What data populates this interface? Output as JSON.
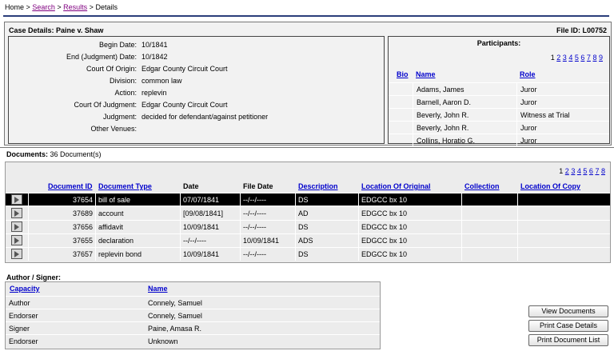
{
  "breadcrumb": {
    "home": "Home",
    "sep": ">",
    "search": "Search",
    "results": "Results",
    "current": "Details"
  },
  "case": {
    "title": "Case Details: Paine v. Shaw",
    "file_id": "File ID: L00752",
    "details": [
      {
        "label": "Begin Date:",
        "value": "10/1841"
      },
      {
        "label": "End (Judgment) Date:",
        "value": "10/1842"
      },
      {
        "label": "Court Of Origin:",
        "value": "Edgar County Circuit Court"
      },
      {
        "label": "Division:",
        "value": "common law"
      },
      {
        "label": "Action:",
        "value": "replevin"
      },
      {
        "label": "Court Of Judgment:",
        "value": "Edgar County Circuit Court"
      },
      {
        "label": "Judgment:",
        "value": "decided for defendant/against petitioner"
      },
      {
        "label": "Other Venues:",
        "value": ""
      }
    ]
  },
  "participants": {
    "title": "Participants:",
    "pages": [
      "1",
      "2",
      "3",
      "4",
      "5",
      "6",
      "7",
      "8",
      "9"
    ],
    "headers": {
      "bio": "Bio",
      "name": "Name",
      "role": "Role"
    },
    "rows": [
      {
        "name": "Adams, James",
        "role": "Juror"
      },
      {
        "name": "Barnell, Aaron D.",
        "role": "Juror"
      },
      {
        "name": "Beverly, John R.",
        "role": "Witness at Trial"
      },
      {
        "name": "Beverly, John R.",
        "role": "Juror"
      },
      {
        "name": "Collins, Horatio G.",
        "role": "Juror"
      }
    ]
  },
  "documents": {
    "label": "Documents:",
    "count": "36 Document(s)",
    "pages": [
      "1",
      "2",
      "3",
      "4",
      "5",
      "6",
      "7",
      "8"
    ],
    "headers": {
      "id": "Document ID",
      "type": "Document Type",
      "date": "Date",
      "file_date": "File Date",
      "description": "Description",
      "location": "Location Of Original",
      "collection": "Collection",
      "copy": "Location Of Copy"
    },
    "rows": [
      {
        "id": "37654",
        "type": "bill of sale",
        "date": "07/07/1841",
        "file_date": "--/--/----",
        "description": "DS",
        "location": "EDGCC bx 10",
        "collection": "",
        "copy": ""
      },
      {
        "id": "37689",
        "type": "account",
        "date": "[09/08/1841]",
        "file_date": "--/--/----",
        "description": "AD",
        "location": "EDGCC bx 10",
        "collection": "",
        "copy": ""
      },
      {
        "id": "37656",
        "type": "affidavit",
        "date": "10/09/1841",
        "file_date": "--/--/----",
        "description": "DS",
        "location": "EDGCC bx 10",
        "collection": "",
        "copy": ""
      },
      {
        "id": "37655",
        "type": "declaration",
        "date": "--/--/----",
        "file_date": "10/09/1841",
        "description": "ADS",
        "location": "EDGCC bx 10",
        "collection": "",
        "copy": ""
      },
      {
        "id": "37657",
        "type": "replevin bond",
        "date": "10/09/1841",
        "file_date": "--/--/----",
        "description": "DS",
        "location": "EDGCC bx 10",
        "collection": "",
        "copy": ""
      }
    ]
  },
  "authors": {
    "label": "Author / Signer:",
    "headers": {
      "capacity": "Capacity",
      "name": "Name"
    },
    "rows": [
      {
        "capacity": "Author",
        "name": "Connely, Samuel"
      },
      {
        "capacity": "Endorser",
        "name": "Connely, Samuel"
      },
      {
        "capacity": "Signer",
        "name": "Paine, Amasa R."
      },
      {
        "capacity": "Endorser",
        "name": "Unknown"
      }
    ]
  },
  "buttons": {
    "view_documents": "View Documents",
    "print_case_details": "Print Case Details",
    "print_document_list": "Print Document List"
  }
}
